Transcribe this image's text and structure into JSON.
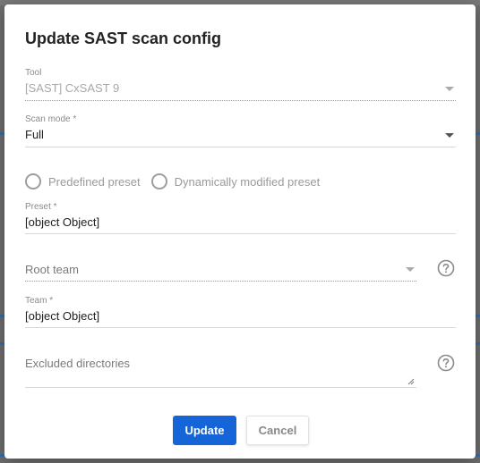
{
  "dialog": {
    "title": "Update SAST scan config",
    "tool": {
      "label": "Tool",
      "value": "[SAST] CxSAST 9"
    },
    "scan_mode": {
      "label": "Scan mode *",
      "value": "Full"
    },
    "preset_type": {
      "options": [
        "Predefined preset",
        "Dynamically modified preset"
      ]
    },
    "preset": {
      "label": "Preset *",
      "value": "[object Object]"
    },
    "root_team": {
      "placeholder": "Root team"
    },
    "team": {
      "label": "Team *",
      "value": "[object Object]"
    },
    "excluded_directories": {
      "placeholder": "Excluded directories"
    },
    "buttons": {
      "update": "Update",
      "cancel": "Cancel"
    }
  },
  "colors": {
    "primary": "#1565d8",
    "overlay": "#707070"
  },
  "icons": {
    "help": "help-circle-icon",
    "dropdown": "chevron-down-icon"
  }
}
